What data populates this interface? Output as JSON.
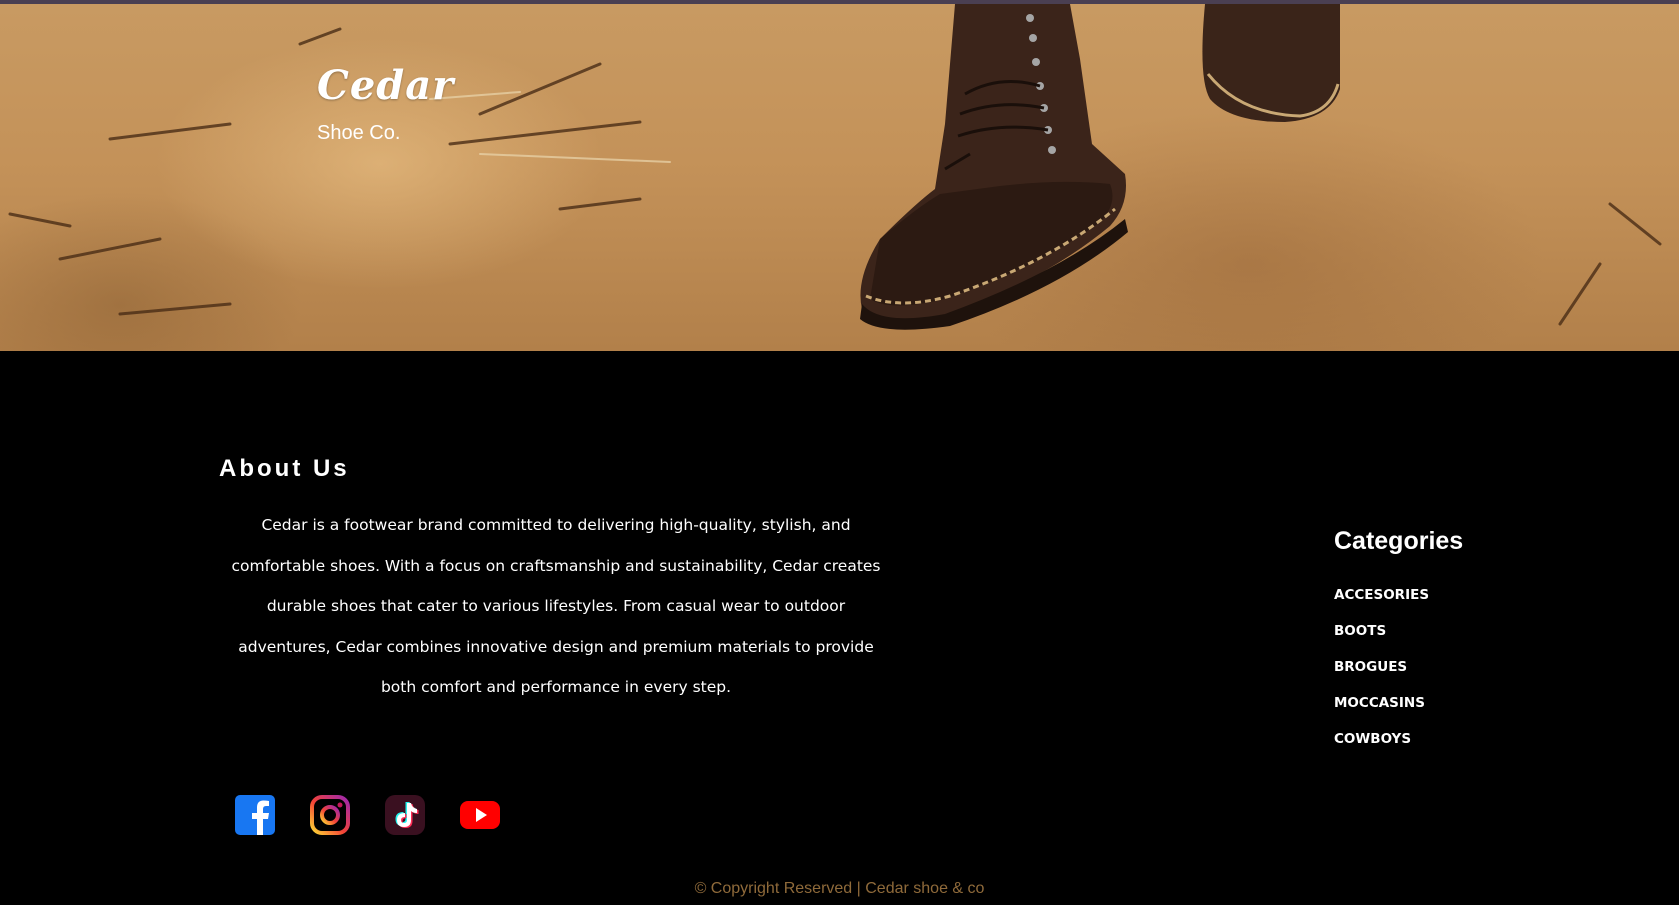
{
  "hero": {
    "brand": "Cedar",
    "tagline": "Shoe Co."
  },
  "about": {
    "title": "About Us",
    "body": "Cedar is a footwear brand committed to delivering high-quality, stylish, and comfortable shoes. With a focus on craftsmanship and sustainability, Cedar creates durable shoes that cater to various lifestyles. From casual wear to outdoor adventures, Cedar combines innovative design and premium materials to provide both comfort and performance in every step."
  },
  "categories": {
    "title": "Categories",
    "items": [
      "ACCESORIES",
      "BOOTS",
      "BROGUES",
      "MOCCASINS",
      "COWBOYS"
    ]
  },
  "social": {
    "icons": [
      "facebook-icon",
      "instagram-icon",
      "tiktok-icon",
      "youtube-icon"
    ]
  },
  "footer": {
    "copyright": "© Copyright Reserved | Cedar shoe & co"
  },
  "colors": {
    "background": "#000000",
    "sand": "#c4925a",
    "copyright": "#8f6a3a",
    "facebook": "#1877f2",
    "youtube": "#ff0000"
  }
}
